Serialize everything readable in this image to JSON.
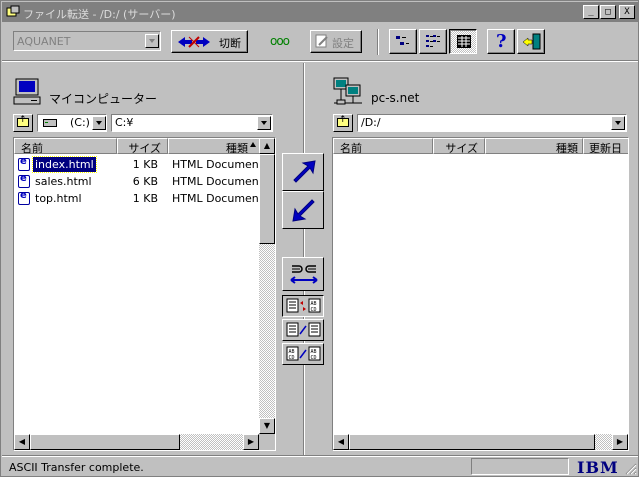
{
  "window": {
    "title": "ファイル転送 - /D:/ (サーバー)",
    "controls": {
      "minimize": "_",
      "maximize": "□",
      "close": "X"
    }
  },
  "toolbar": {
    "host": "AQUANET",
    "disconnect_label": "切断",
    "settings_label": "設定",
    "status_indicator": "ooo"
  },
  "local": {
    "title": "マイコンピューター",
    "drive": "(C:)",
    "path": "C:¥",
    "columns": [
      "名前",
      "サイズ",
      "種類"
    ],
    "files": [
      {
        "name": "index.html",
        "size": "1 KB",
        "type": "HTML Document",
        "selected": true
      },
      {
        "name": "sales.html",
        "size": "6 KB",
        "type": "HTML Document",
        "selected": false
      },
      {
        "name": "top.html",
        "size": "1 KB",
        "type": "HTML Document",
        "selected": false
      }
    ]
  },
  "remote": {
    "title": "pc-s.net",
    "path": "/D:/",
    "columns": [
      "名前",
      "サイズ",
      "種類",
      "更新日"
    ],
    "files": []
  },
  "status": {
    "message": "ASCII Transfer complete.",
    "brand": "IBM"
  },
  "colors": {
    "accent": "#000080",
    "face": "#c0c0c0",
    "arrow": "#0000c0",
    "selection": "#000080"
  }
}
